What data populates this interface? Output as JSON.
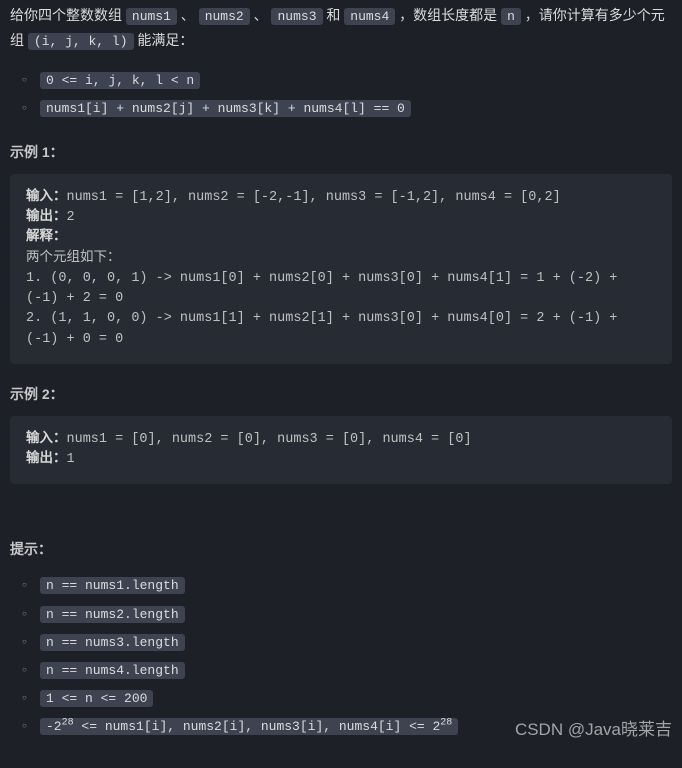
{
  "description": {
    "prefix": "给你四个整数数组 ",
    "arr1": "nums1",
    "sep1": " 、 ",
    "arr2": "nums2",
    "sep2": " 、 ",
    "arr3": "nums3",
    "sep3": " 和 ",
    "arr4": "nums4",
    "mid1": " ，数组长度都是 ",
    "nvar": "n",
    "mid2": " ，请你计算有多少个元组 ",
    "tuple": "(i, j, k, l)",
    "suffix": " 能满足："
  },
  "conditions": [
    "0 <= i, j, k, l < n",
    "nums1[i] + nums2[j] + nums3[k] + nums4[l] == 0"
  ],
  "example1": {
    "title": "示例 1：",
    "input_label": "输入：",
    "input_value": "nums1 = [1,2], nums2 = [-2,-1], nums3 = [-1,2], nums4 = [0,2]",
    "output_label": "输出：",
    "output_value": "2",
    "explain_label": "解释：",
    "detail_label": "两个元组如下：",
    "detail_line1": "1. (0, 0, 0, 1) -> nums1[0] + nums2[0] + nums3[0] + nums4[1] = 1 + (-2) + (-1) + 2 = 0",
    "detail_line2": "2. (1, 1, 0, 0) -> nums1[1] + nums2[1] + nums3[0] + nums4[0] = 2 + (-1) + (-1) + 0 = 0"
  },
  "example2": {
    "title": "示例 2：",
    "input_label": "输入：",
    "input_value": "nums1 = [0], nums2 = [0], nums3 = [0], nums4 = [0]",
    "output_label": "输出：",
    "output_value": "1"
  },
  "hints": {
    "title": "提示：",
    "items": [
      "n == nums1.length",
      "n == nums2.length",
      "n == nums3.length",
      "n == nums4.length",
      "1 <= n <= 200"
    ],
    "last_prefix": "-2",
    "last_exp1": "28",
    "last_mid": " <= nums1[i], nums2[i], nums3[i], nums4[i] <= 2",
    "last_exp2": "28"
  },
  "watermark": "CSDN @Java晓莱吉"
}
